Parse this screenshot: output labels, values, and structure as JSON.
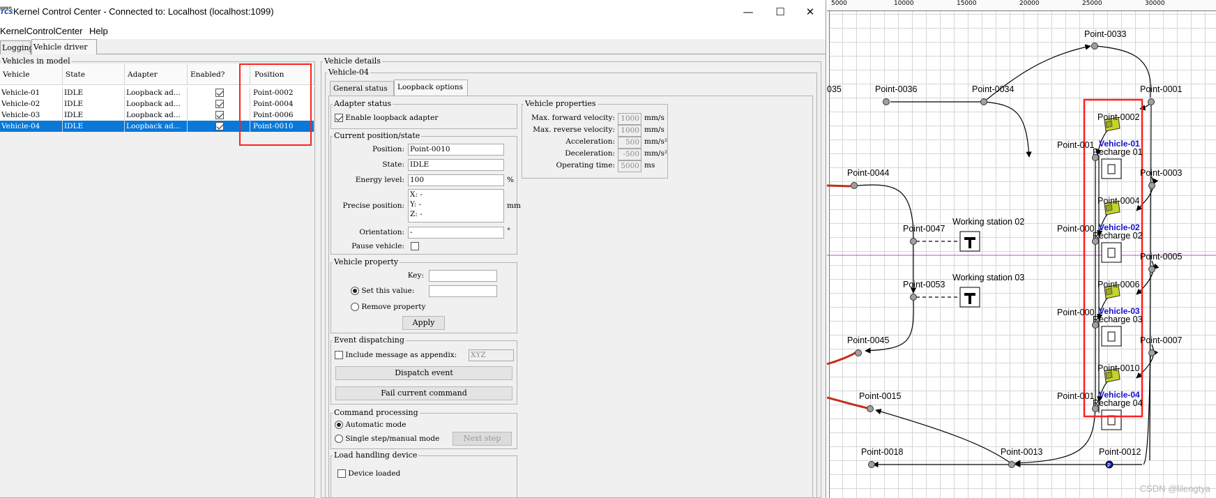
{
  "window": {
    "logo_top": "open",
    "logo_bottom": "TCS",
    "title": "Kernel Control Center - Connected to: Localhost (localhost:1099)",
    "minimize": "—",
    "maximize": "☐",
    "close": "✕"
  },
  "menu": [
    "KernelControlCenter",
    "Help"
  ],
  "tabs": [
    "Logging",
    "Vehicle driver"
  ],
  "vehicles_panel": {
    "title": "Vehicles in model",
    "columns": [
      "Vehicle",
      "State",
      "Adapter",
      "Enabled?",
      "Position"
    ],
    "rows": [
      {
        "vehicle": "Vehicle-01",
        "state": "IDLE",
        "adapter": "Loopback ad...",
        "enabled": true,
        "position": "Point-0002"
      },
      {
        "vehicle": "Vehicle-02",
        "state": "IDLE",
        "adapter": "Loopback ad...",
        "enabled": true,
        "position": "Point-0004"
      },
      {
        "vehicle": "Vehicle-03",
        "state": "IDLE",
        "adapter": "Loopback ad...",
        "enabled": true,
        "position": "Point-0006"
      },
      {
        "vehicle": "Vehicle-04",
        "state": "IDLE",
        "adapter": "Loopback ad...",
        "enabled": true,
        "position": "Point-0010"
      }
    ],
    "selected_row": 3
  },
  "details": {
    "title": "Vehicle details",
    "vehicle_name": "Vehicle-04",
    "subtabs": [
      "General status",
      "Loopback options"
    ],
    "adapter_status": {
      "title": "Adapter status",
      "enable_label": "Enable loopback adapter",
      "enabled": true
    },
    "current_state": {
      "title": "Current position/state",
      "position_label": "Position:",
      "position": "Point-0010",
      "state_label": "State:",
      "state": "IDLE",
      "energy_label": "Energy level:",
      "energy": "100",
      "energy_unit": "%",
      "precise_label": "Precise position:",
      "precise_x": "X: -",
      "precise_y": "Y: -",
      "precise_z": "Z: -",
      "precise_unit": "mm",
      "orientation_label": "Orientation:",
      "orientation": "-",
      "orientation_unit": "°",
      "pause_label": "Pause vehicle:",
      "pause": false
    },
    "vehicle_property": {
      "title": "Vehicle property",
      "key_label": "Key:",
      "key": "",
      "set_label": "Set this value:",
      "set_value": "",
      "remove_label": "Remove property",
      "apply": "Apply"
    },
    "event_dispatching": {
      "title": "Event dispatching",
      "include_label": "Include message as appendix:",
      "appendix": "XYZ",
      "dispatch": "Dispatch event",
      "fail": "Fail current command"
    },
    "command_processing": {
      "title": "Command processing",
      "auto_label": "Automatic mode",
      "manual_label": "Single step/manual mode",
      "next": "Next step",
      "mode": "automatic"
    },
    "load_handling": {
      "title": "Load handling device",
      "loaded_label": "Device loaded",
      "loaded": false
    },
    "properties": {
      "title": "Vehicle properties",
      "rows": [
        {
          "label": "Max. forward velocity:",
          "value": "1000",
          "unit": "mm/s"
        },
        {
          "label": "Max. reverse velocity:",
          "value": "1000",
          "unit": "mm/s"
        },
        {
          "label": "Acceleration:",
          "value": "500",
          "unit": "mm/s²"
        },
        {
          "label": "Deceleration:",
          "value": "-500",
          "unit": "mm/s²"
        },
        {
          "label": "Operating time:",
          "value": "5000",
          "unit": "ms"
        }
      ]
    }
  },
  "plant": {
    "ruler": [
      "5000",
      "10000",
      "15000",
      "20000",
      "25000",
      "30000"
    ],
    "point_labels": [
      "Point-0033",
      "Point-0036",
      "Point-0034",
      "Point-0001",
      "Point-0002",
      "Point-0003",
      "Point-0004",
      "Point-0005",
      "Point-0006",
      "Point-0007",
      "Point-0010",
      "Point-0012",
      "Point-0013",
      "Point-0018",
      "Point-0015",
      "Point-0045",
      "Point-0044",
      "Point-0047",
      "Point-0053",
      "035",
      "Point-001",
      "Point-000",
      "Point-000",
      "Point-001"
    ],
    "station_labels": [
      "Working station 02",
      "Working station 03"
    ],
    "recharge_labels": [
      "Recharge 01",
      "Recharge 02",
      "Recharge 03",
      "Recharge 04"
    ],
    "vehicle_labels": [
      "Vehicle-01",
      "Vehicle-02",
      "Vehicle-03",
      "Vehicle-04"
    ],
    "watermark": "CSDN @lilengtya"
  }
}
